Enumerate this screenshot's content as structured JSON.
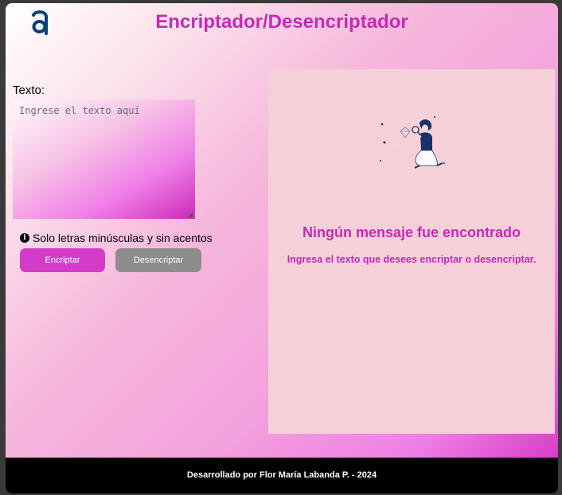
{
  "header": {
    "logo_icon": "alura-a-logo-icon",
    "title": "Encriptador/Desencriptador"
  },
  "input": {
    "label": "Texto:",
    "placeholder": "Ingrese el texto aquí",
    "value": ""
  },
  "hint": {
    "icon": "info-icon",
    "text": "Solo letras minúsculas y sin acentos"
  },
  "buttons": {
    "encrypt_label": "Encriptar",
    "decrypt_label": "Desencriptar"
  },
  "result": {
    "illustration": "person-with-magnifier-illustration",
    "title": "Ningún mensaje fue encontrado",
    "subtitle": "Ingresa el texto que desees encriptar o desencriptar."
  },
  "footer": {
    "text": "Desarrollado por Flor María Labanda P. - 2024"
  },
  "colors": {
    "accent": "#c629b6",
    "encrypt_button": "#d33bc8",
    "decrypt_button": "#8d8d8d",
    "result_panel": "#f5d0d9",
    "footer_bg": "#000000"
  }
}
